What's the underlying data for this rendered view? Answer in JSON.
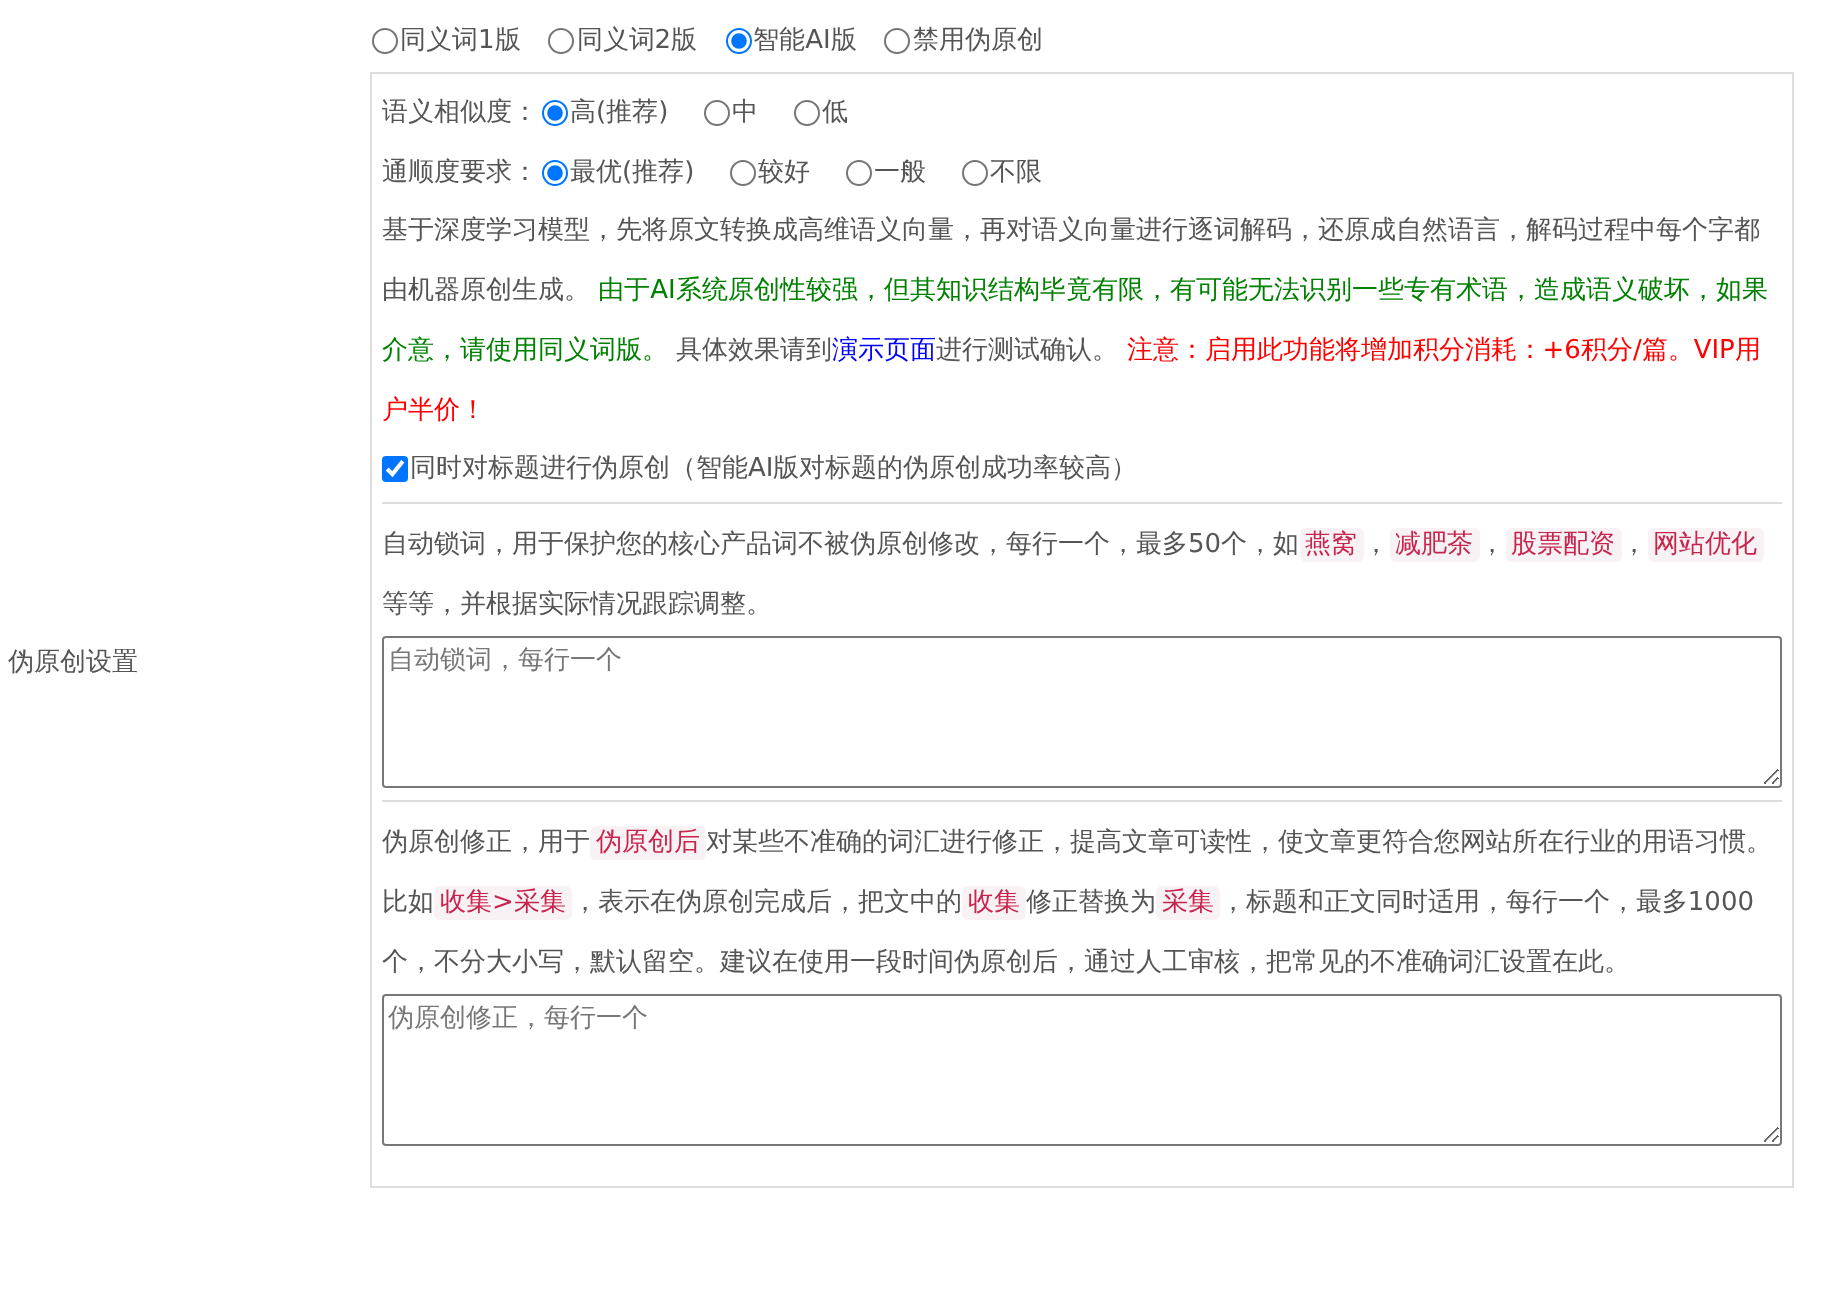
{
  "side_label": "伪原创设置",
  "modes": [
    {
      "label": "同义词1版",
      "selected": false
    },
    {
      "label": "同义词2版",
      "selected": false
    },
    {
      "label": "智能AI版",
      "selected": true
    },
    {
      "label": "禁用伪原创",
      "selected": false
    }
  ],
  "similarity": {
    "label": "语义相似度：",
    "options": [
      {
        "label": "高(推荐)",
        "selected": true
      },
      {
        "label": "中",
        "selected": false
      },
      {
        "label": "低",
        "selected": false
      }
    ]
  },
  "fluency": {
    "label": "通顺度要求：",
    "options": [
      {
        "label": "最优(推荐)",
        "selected": true
      },
      {
        "label": "较好",
        "selected": false
      },
      {
        "label": "一般",
        "selected": false
      },
      {
        "label": "不限",
        "selected": false
      }
    ]
  },
  "description": [
    {
      "kind": "text",
      "text": "基于深度学习模型，先将原文转换成高维语义向量，再对语义向量进行逐词解码，还原成自然语言，解码过程中每个字都由机器原创生成。 "
    },
    {
      "kind": "notice",
      "text": "由于AI系统原创性较强，但其知识结构毕竟有限，有可能无法识别一些专有术语，造成语义破坏，如果介意，请使用同义词版。"
    },
    {
      "kind": "text",
      "text": " 具体效果请到"
    },
    {
      "kind": "link",
      "text": "演示页面"
    },
    {
      "kind": "text",
      "text": "进行测试确认。 "
    },
    {
      "kind": "warning",
      "text": "注意：启用此功能将增加积分消耗：+6积分/篇。VIP用户半价！"
    }
  ],
  "title_option": {
    "label": "同时对标题进行伪原创（智能AI版对标题的伪原创成功率较高）",
    "checked": true
  },
  "lock_words": {
    "description": [
      {
        "kind": "text",
        "text": "自动锁词，用于保护您的核心产品词不被伪原创修改，每行一个，最多50个，如"
      },
      {
        "kind": "code",
        "text": "燕窝"
      },
      {
        "kind": "text",
        "text": "，"
      },
      {
        "kind": "code",
        "text": "减肥茶"
      },
      {
        "kind": "text",
        "text": "，"
      },
      {
        "kind": "code",
        "text": "股票配资"
      },
      {
        "kind": "text",
        "text": "，"
      },
      {
        "kind": "code",
        "text": "网站优化"
      },
      {
        "kind": "text",
        "text": " 等等，并根据实际情况跟踪调整。"
      }
    ],
    "placeholder": "自动锁词，每行一个"
  },
  "correction": {
    "description": [
      {
        "kind": "text",
        "text": "伪原创修正，用于"
      },
      {
        "kind": "code",
        "text": "伪原创后"
      },
      {
        "kind": "text",
        "text": "对某些不准确的词汇进行修正，提高文章可读性，使文章更符合您网站所在行业的用语习惯。比如"
      },
      {
        "kind": "code",
        "text": "收集>采集"
      },
      {
        "kind": "text",
        "text": "，表示在伪原创完成后，把文中的"
      },
      {
        "kind": "code",
        "text": "收集"
      },
      {
        "kind": "text",
        "text": "修正替换为"
      },
      {
        "kind": "code",
        "text": "采集"
      },
      {
        "kind": "text",
        "text": "，标题和正文同时适用，每行一个，最多1000个，不分大小写，默认留空。建议在使用一段时间伪原创后，通过人工审核，把常见的不准确词汇设置在此。"
      }
    ],
    "placeholder": "伪原创修正，每行一个"
  }
}
